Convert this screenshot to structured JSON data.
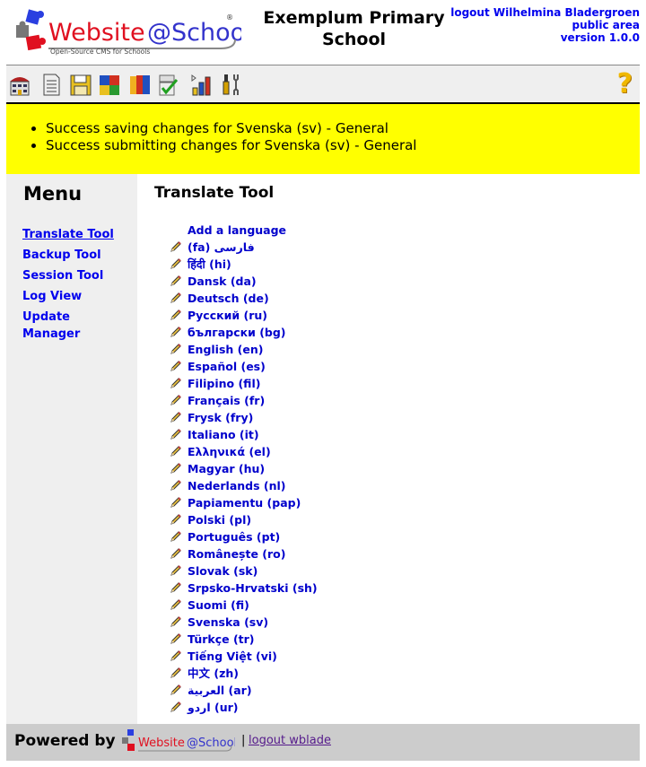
{
  "header": {
    "logo_alt": "Website@School",
    "logo_tagline": "Open-Source CMS for Schools",
    "site_title_line1": "Exemplum Primary",
    "site_title_line2": "School",
    "logout_label": "logout Wilhelmina Bladergroen",
    "area_label": "public area",
    "version_label": "version 1.0.0"
  },
  "toolbar": {
    "icons": [
      "start-center-icon",
      "page-manager-icon",
      "files-icon",
      "modules-icon",
      "account-manager-icon",
      "configuration-manager-icon",
      "statistics-icon",
      "tools-icon"
    ],
    "help_label": "?"
  },
  "messages": [
    "Success saving changes for Svenska (sv) - General",
    "Success submitting changes for Svenska (sv) - General"
  ],
  "menu": {
    "title": "Menu",
    "items": [
      {
        "label": "Translate Tool",
        "active": true
      },
      {
        "label": "Backup Tool",
        "active": false
      },
      {
        "label": "Session Tool",
        "active": false
      },
      {
        "label": "Log View",
        "active": false
      },
      {
        "label": "Update Manager",
        "active": false
      }
    ]
  },
  "content": {
    "title": "Translate Tool",
    "add_language_label": "Add a language",
    "languages": [
      "(fa) فارسی",
      "हिंदी (hi)",
      "Dansk (da)",
      "Deutsch (de)",
      "Русский (ru)",
      "български (bg)",
      "English (en)",
      "Español (es)",
      "Filipino (fil)",
      "Français (fr)",
      "Frysk (fry)",
      "Italiano (it)",
      "Ελληνικά (el)",
      "Magyar (hu)",
      "Nederlands (nl)",
      "Papiamentu (pap)",
      "Polski (pl)",
      "Português (pt)",
      "Românește (ro)",
      "Slovak (sk)",
      "Srpsko-Hrvatski (sh)",
      "Suomi (fi)",
      "Svenska (sv)",
      "Türkçe (tr)",
      "Tiếng Việt (vi)",
      "中文 (zh)",
      "العربية (ar)",
      "اردو (ur)"
    ]
  },
  "footer": {
    "powered_by": "Powered by",
    "separator": "|",
    "logout_label": "logout wblade"
  },
  "colors": {
    "link": "#0000ee",
    "message_bg": "#ffff00",
    "menu_bg": "#efefef",
    "footer_bg": "#cccccc"
  }
}
